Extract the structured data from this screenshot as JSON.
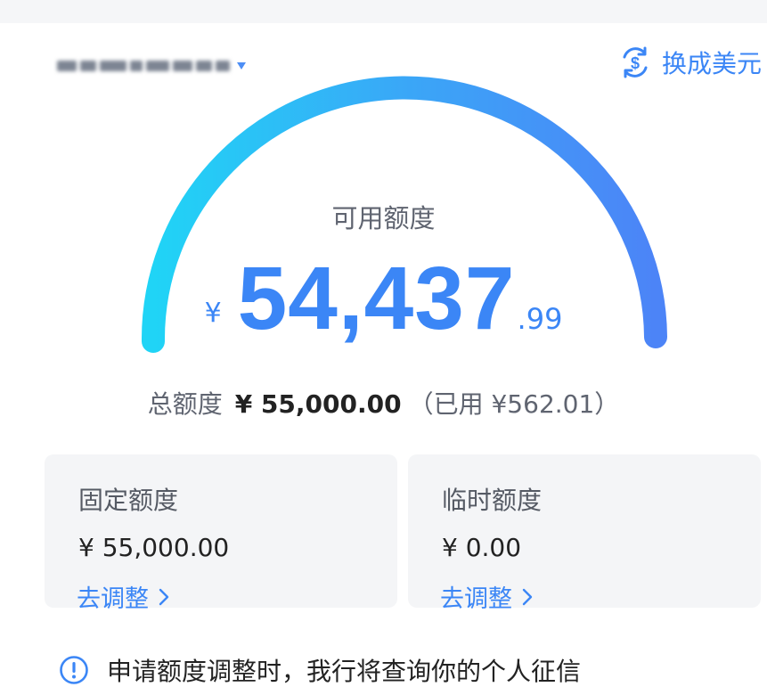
{
  "header": {
    "currency_switch_label": "换成美元"
  },
  "gauge": {
    "available_label": "可用额度",
    "currency_symbol": "¥",
    "available_integer": "54,437",
    "available_decimal": ".99"
  },
  "total": {
    "label": "总额度",
    "value": "¥ 55,000.00",
    "used_text": "（已用 ¥562.01）"
  },
  "cards": {
    "fixed": {
      "title": "固定额度",
      "value": "¥ 55,000.00",
      "link": "去调整"
    },
    "temporary": {
      "title": "临时额度",
      "value": "¥ 0.00",
      "link": "去调整"
    }
  },
  "notice": {
    "text": "申请额度调整时，我行将查询你的个人征信"
  },
  "colors": {
    "accent": "#3b86f6",
    "gauge_start": "#20d4f6",
    "gauge_end": "#4c84f7",
    "card_bg": "#f4f5f7"
  },
  "icons": {
    "currency_switch": "dollar-exchange-icon",
    "card_link": "chevron-right-icon",
    "notice": "info-circle-icon"
  }
}
